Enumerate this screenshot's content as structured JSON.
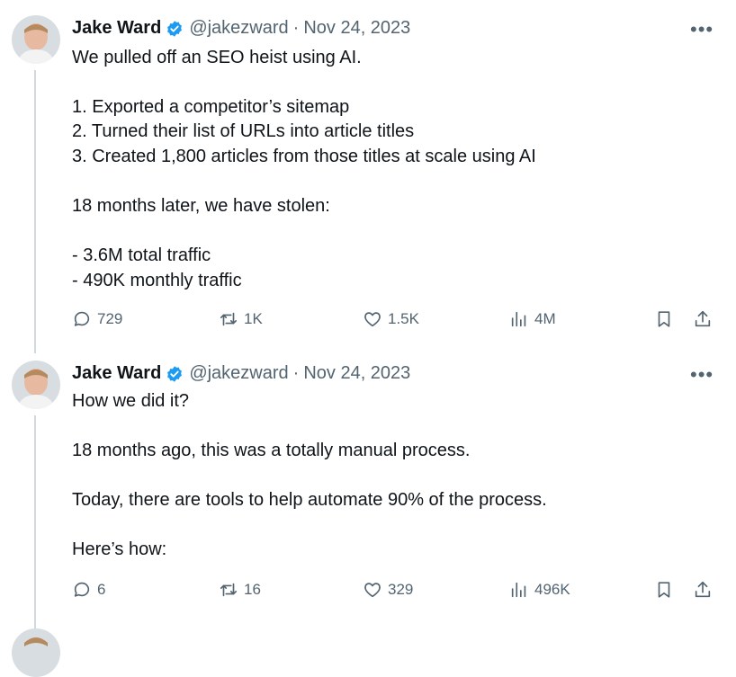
{
  "tweets": [
    {
      "author": {
        "name": "Jake Ward",
        "handle": "@jakezward",
        "separator": "·",
        "date": "Nov 24, 2023",
        "verified": true
      },
      "lines": [
        "We pulled off an SEO heist using AI.",
        "1. Exported a competitor’s sitemap",
        "2. Turned their list of URLs into article titles",
        "3. Created 1,800 articles from those titles at scale using AI",
        "18 months later, we have stolen:",
        "- 3.6M total traffic",
        "- 490K monthly traffic"
      ],
      "stats": {
        "replies": "729",
        "reposts": "1K",
        "likes": "1.5K",
        "views": "4M"
      }
    },
    {
      "author": {
        "name": "Jake Ward",
        "handle": "@jakezward",
        "separator": "·",
        "date": "Nov 24, 2023",
        "verified": true
      },
      "lines": [
        "How we did it?",
        "18 months ago, this was a totally manual process.",
        "Today, there are tools to help automate 90% of the process.",
        "Here’s how:"
      ],
      "stats": {
        "replies": "6",
        "reposts": "16",
        "likes": "329",
        "views": "496K"
      }
    }
  ],
  "icons": {
    "reply": "reply-icon",
    "repost": "repost-icon",
    "like": "heart-icon",
    "views": "views-icon",
    "bookmark": "bookmark-icon",
    "share": "share-icon",
    "more": "more-icon",
    "verified": "verified-badge-icon"
  },
  "colors": {
    "verified": "#1d9bf0",
    "secondary_text": "#536471",
    "thread_line": "#cfd9de"
  }
}
